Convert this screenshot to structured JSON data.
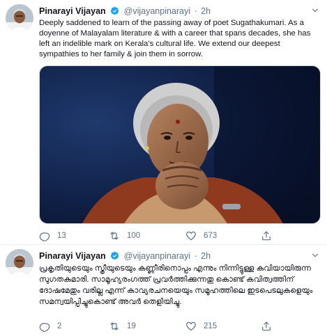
{
  "tweets": [
    {
      "author_name": "Pinarayi Vijayan",
      "author_handle": "@vijayanpinarayi",
      "time": "2h",
      "text": "Deeply saddened to learn of the passing away of poet Sugathakumari. As a doyenne of Malayalam literature & with a career that spans decades, she has left an indelible mark on Kerala's cultural life. We extend our deepest sympathies to her family & join them in sorrow.",
      "replies": "13",
      "retweets": "100",
      "likes": "673",
      "media": {
        "present": true,
        "description_icon": "photo-portrait"
      }
    },
    {
      "author_name": "Pinarayi Vijayan",
      "author_handle": "@vijayanpinarayi",
      "time": "2h",
      "text": "പ്രകൃതിയുടെയും സ്ത്രീയുടെയും കണ്ണീരിനൊപ്പം എന്നും നിന്നിട്ടുള്ള കവിയായിരുന്ന സുഗതകുമാരി. സാമൂഹ്യരംഗത്ത് പ്രവർത്തിക്കുന്നതു കൊണ്ട് കവിത്വത്തിന് ദോഷമേതും വരില്ല എന്ന് കാവ്യരചനയെയും സമൂഹത്തിലെ ഇടപെടലുകളെയും സമന്വയിപ്പിച്ചുകൊണ്ട് അവർ തെളിയിച്ചു.",
      "replies": "2",
      "retweets": "19",
      "likes": "215"
    }
  ],
  "icons": {
    "verified": "verified-badge-icon",
    "reply": "reply-icon",
    "retweet": "retweet-icon",
    "like": "heart-icon",
    "share": "share-icon",
    "more": "chevron-down-icon"
  },
  "colors": {
    "text": "#0f1419",
    "secondary": "#5b7083",
    "verified": "#1da1f2",
    "divider": "#e6ecf0"
  }
}
